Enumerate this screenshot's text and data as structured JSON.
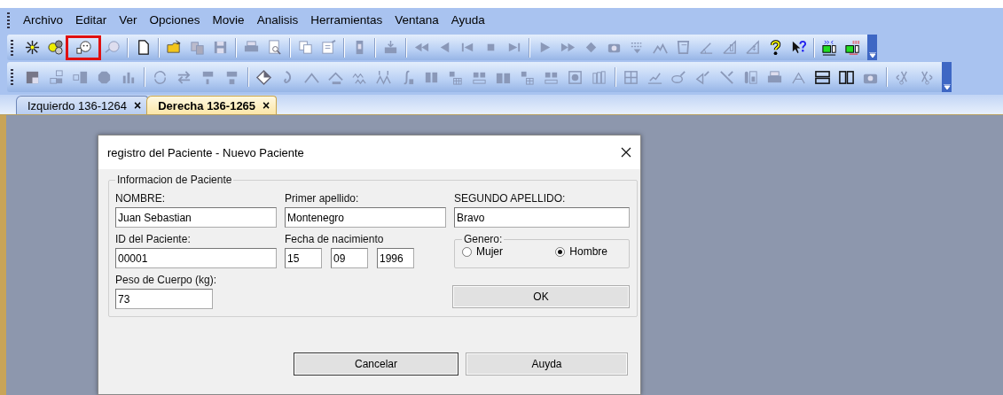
{
  "menu": [
    "Archivo",
    "Editar",
    "Ver",
    "Opciones",
    "Movie",
    "Analisis",
    "Herramientas",
    "Ventana",
    "Ayuda"
  ],
  "toolbar": {
    "groups": [
      [
        {
          "highlighted": false
        },
        {
          "highlighted": false
        },
        {
          "highlighted": true
        },
        {
          "highlighted": false
        }
      ],
      [
        {
          "highlighted": false
        }
      ],
      [
        {
          "highlighted": false
        },
        {
          "highlighted": false
        },
        {
          "highlighted": false
        }
      ],
      [
        {
          "highlighted": false
        },
        {
          "highlighted": false
        }
      ],
      [
        {
          "highlighted": false
        },
        {
          "highlighted": false
        }
      ],
      [
        {
          "highlighted": false
        }
      ],
      [
        {
          "highlighted": false
        }
      ],
      [
        {
          "highlighted": false
        },
        {
          "highlighted": false
        },
        {
          "highlighted": false
        },
        {
          "highlighted": false
        },
        {
          "highlighted": false
        }
      ],
      [
        {
          "highlighted": false
        },
        {
          "highlighted": false
        },
        {
          "highlighted": false
        },
        {
          "highlighted": false
        },
        {
          "highlighted": false
        },
        {
          "highlighted": false
        },
        {
          "highlighted": false
        },
        {
          "highlighted": false
        },
        {
          "highlighted": false
        },
        {
          "highlighted": false
        },
        {
          "highlighted": false
        },
        {
          "highlighted": false
        }
      ],
      [
        {
          "highlighted": false
        },
        {
          "highlighted": false
        }
      ]
    ]
  },
  "tabs": [
    {
      "label": "Izquierdo 136-1264",
      "close": "×",
      "selected": false
    },
    {
      "label": "Derecha 136-1265",
      "close": "×",
      "selected": true
    }
  ],
  "dialog": {
    "title": "registro del Paciente - Nuevo Paciente",
    "group": "Informacion de Paciente",
    "fields": [
      {
        "label": "NOMBRE:",
        "value": "Juan Sebastian"
      },
      {
        "label": "Primer apellido:",
        "value": "Montenegro"
      },
      {
        "label": "SEGUNDO APELLIDO:",
        "value": "Bravo"
      },
      {
        "label": "ID del Paciente:",
        "value": "00001"
      }
    ],
    "birth_date": {
      "label": "Fecha de nacimiento",
      "day": "15",
      "month": "09",
      "year": "1996"
    },
    "gender": {
      "label": "Genero:",
      "options": [
        {
          "label": "Mujer",
          "selected": false
        },
        {
          "label": "Hombre",
          "selected": true
        }
      ]
    },
    "weight": {
      "label": "Peso de Cuerpo (kg):",
      "value": "73"
    },
    "buttons": {
      "ok": "OK",
      "cancel": "Cancelar",
      "help": "Auyda"
    }
  }
}
